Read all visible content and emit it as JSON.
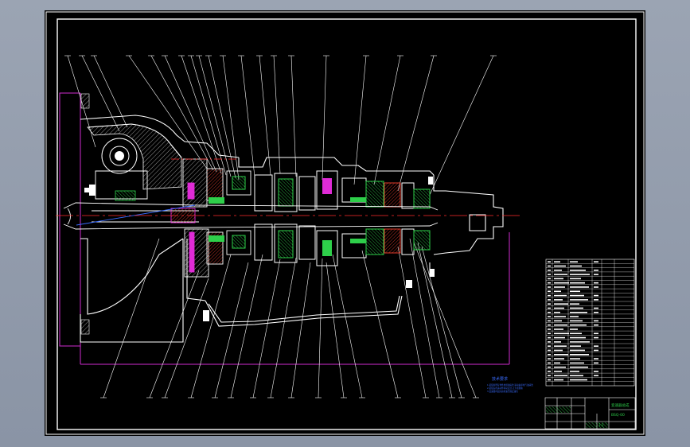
{
  "viewport": {
    "background_color": "#8b95a6",
    "paper_color": "#000000",
    "frame_color": "#ffffff"
  },
  "drawing": {
    "subject": "transmission assembly cross-section",
    "colors": {
      "outline": "#ffffff",
      "centerline": "#ff2a2a",
      "boundary": "#d12bd1",
      "leader": "#ffffff",
      "hatch": "#e0e0e0",
      "gear_green": "#2ecf4a",
      "gear_red": "#e33b2b",
      "gear_magenta": "#e02bd6",
      "note_blue": "#3a6cff",
      "table_green": "#2ecf4a"
    }
  },
  "notes": {
    "heading": "技术要求",
    "lines": [
      "1.装配前所有零件用煤油清洗,滚动轴承用汽油清洗",
      "2.装配后各运动件转动灵活,无卡滞现象",
      "3.变速器内加注齿轮油至规定油位"
    ]
  },
  "title_block": {
    "name": "变速器总成",
    "drawing_no": "BSQ-00",
    "scale": "1:1"
  }
}
